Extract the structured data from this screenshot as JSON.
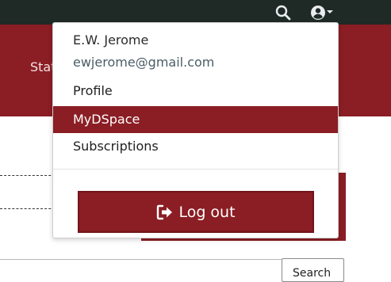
{
  "header": {
    "nav_partial": "Stat"
  },
  "topbar": {
    "search_icon": "search-icon",
    "user_icon": "user-circle-icon"
  },
  "dropdown": {
    "user_name": "E.W. Jerome",
    "user_email": "ewjerome@gmail.com",
    "items": [
      {
        "label": "Profile"
      },
      {
        "label": "MyDSpace",
        "active": true
      },
      {
        "label": "Subscriptions"
      }
    ],
    "logout_label": "Log out",
    "logout_icon": "sign-out-icon"
  },
  "search": {
    "button_label": "Search"
  },
  "colors": {
    "brand": "#8b1d24",
    "topbar": "#1f2926"
  }
}
